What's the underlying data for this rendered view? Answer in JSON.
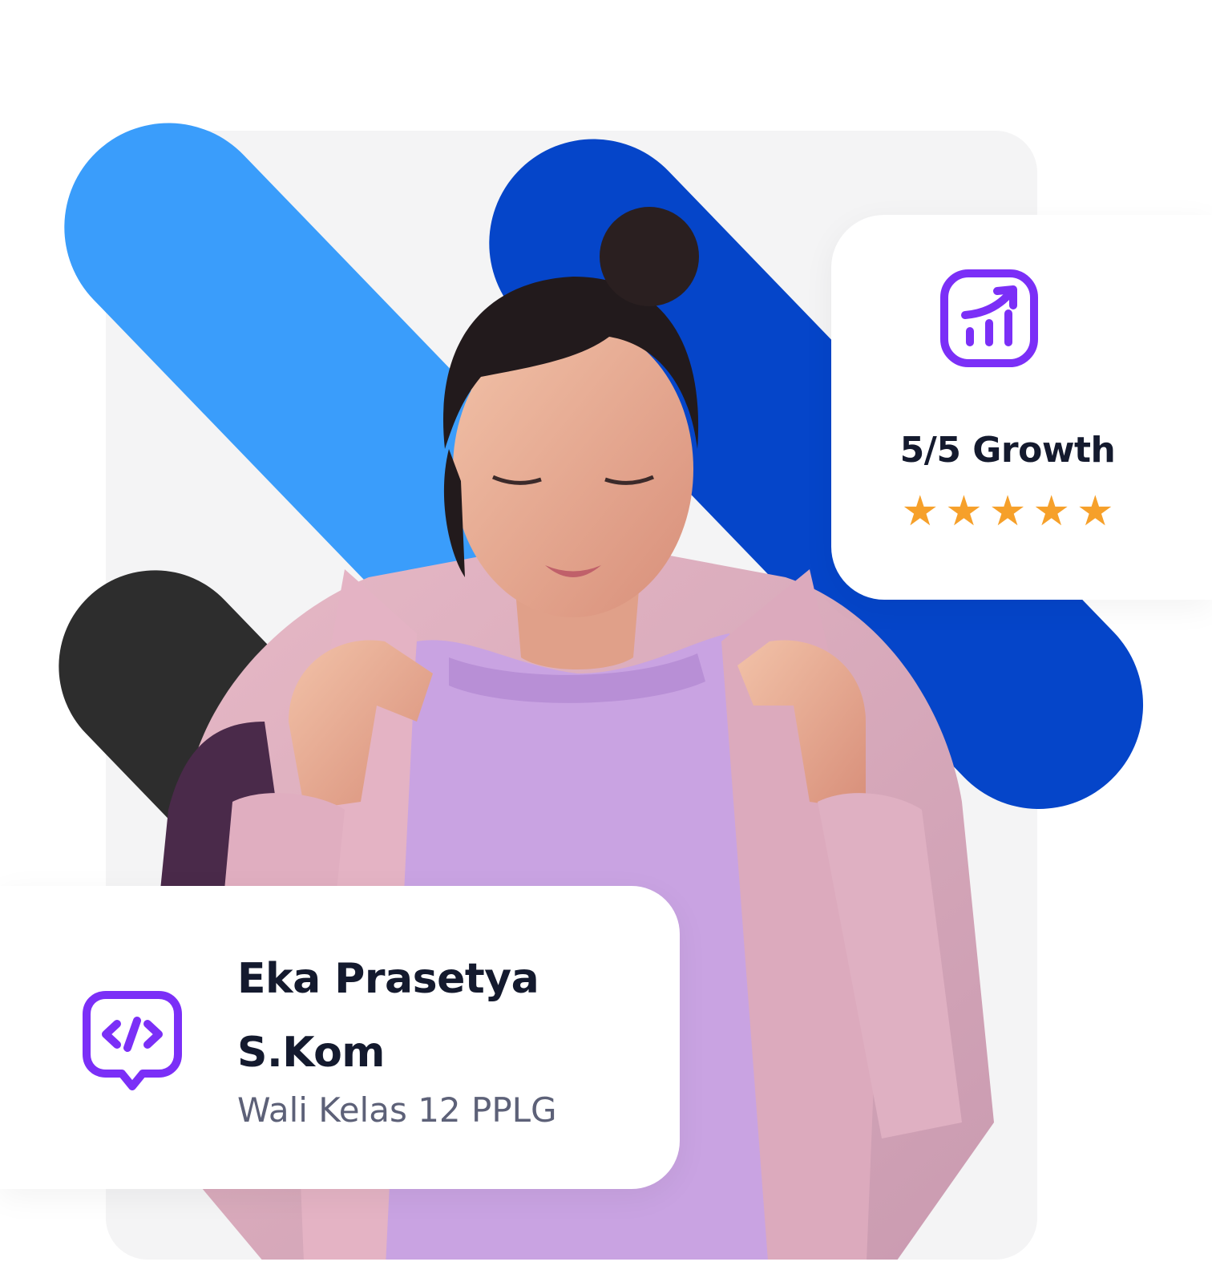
{
  "colors": {
    "light_blue": "#3a9dfb",
    "dark_blue": "#0545c9",
    "charcoal": "#2d2d2d",
    "accent_purple": "#7b2ff7",
    "star_orange": "#f6a02a",
    "text_dark": "#141a2e",
    "text_muted": "#5d6178"
  },
  "growth_card": {
    "icon": "chart-growth-icon",
    "title": "5/5 Growth",
    "rating": 5,
    "rating_max": 5,
    "star_glyph": "★"
  },
  "profile_card": {
    "icon": "code-chat-icon",
    "name_line1": "Eka Prasetya",
    "name_line2": "S.Kom",
    "role": "Wali Kelas 12 PPLG"
  }
}
